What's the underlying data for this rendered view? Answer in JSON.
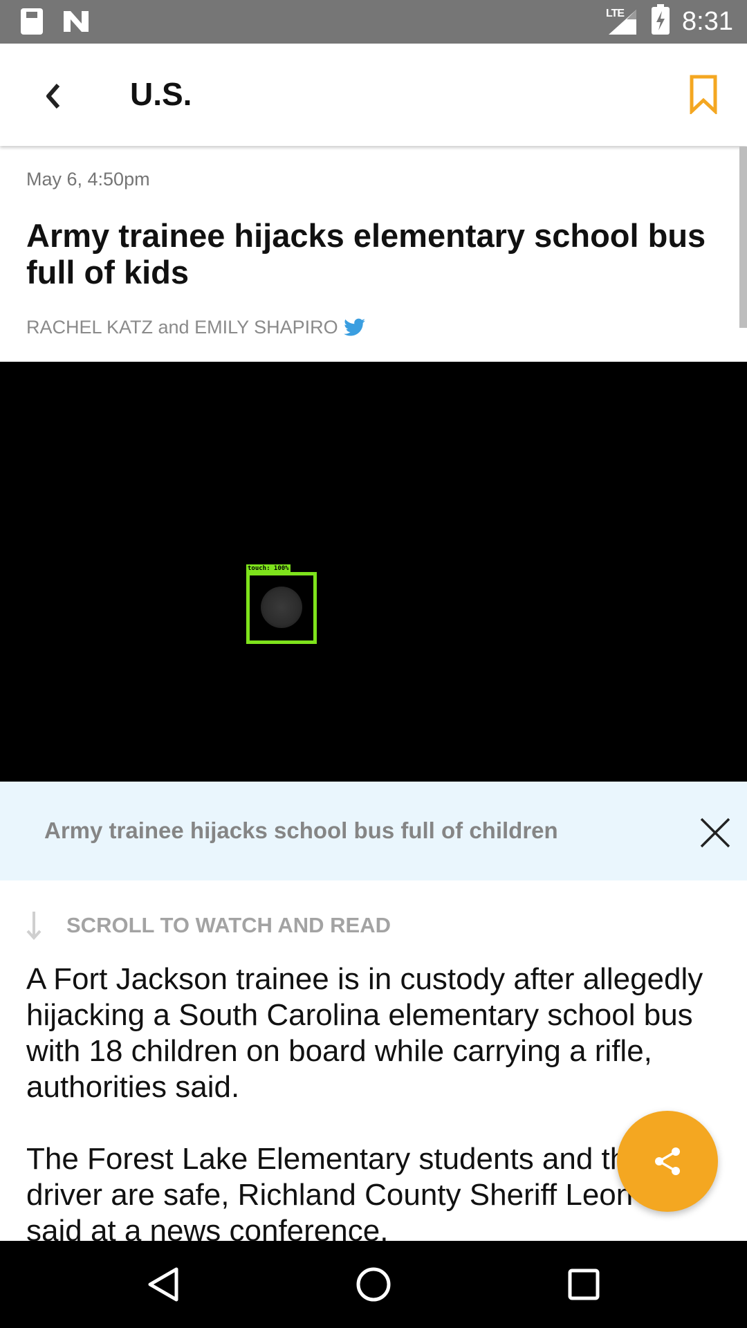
{
  "status_bar": {
    "time": "8:31",
    "network": "LTE",
    "icons": [
      "sd-card-icon",
      "n-notification-icon",
      "signal-icon",
      "battery-charging-icon"
    ]
  },
  "header": {
    "section_title": "U.S.",
    "back_icon": "chevron-left-icon",
    "bookmark_icon": "bookmark-icon",
    "accent_color": "#f4a721"
  },
  "article": {
    "date": "May 6, 4:50pm",
    "title": "Army trainee hijacks elementary school bus full of kids",
    "byline": "RACHEL KATZ and EMILY SHAPIRO",
    "byline_icon": "twitter-icon",
    "paragraphs": [
      "A Fort Jackson trainee is in custody after allegedly hijacking a South Carolina elementary school bus with 18 children on board while carrying a rifle, authorities said.",
      "The Forest Lake Elementary students and the bus driver are safe, Richland County Sheriff Leon Lott said at a news conference."
    ]
  },
  "video": {
    "overlay_label": "touch: 100%",
    "caption": "Army trainee hijacks school bus full of children",
    "close_icon": "close-icon"
  },
  "scroll_hint": {
    "text": "SCROLL TO WATCH AND READ",
    "icon": "arrow-down-icon"
  },
  "share": {
    "icon": "share-icon",
    "color": "#f4a721"
  },
  "nav_bar": {
    "buttons": [
      "back-triangle-icon",
      "home-circle-icon",
      "recents-square-icon"
    ]
  }
}
